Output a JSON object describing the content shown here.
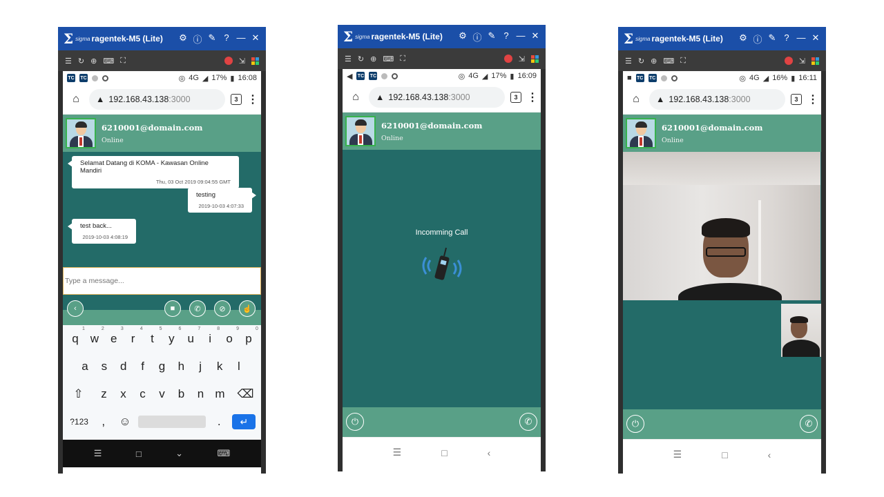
{
  "window": {
    "logo": "Σ",
    "logo_sub": "sigma",
    "title": "ragentek-M5 (Lite)",
    "title_icons": [
      "gear-icon",
      "info-icon",
      "pin-icon",
      "help-icon",
      "minimize-icon",
      "close-icon"
    ]
  },
  "browser": {
    "url_host": "192.168.43.138",
    "url_port": ":3000",
    "tab_count": "3"
  },
  "contact": {
    "name": "6210001@domain.com",
    "status": "Online"
  },
  "screens": {
    "chat": {
      "status": {
        "network": "4G",
        "battery": "17%",
        "time": "16:08"
      },
      "messages": [
        {
          "direction": "in",
          "text": "Selamat Datang di KOMA - Kawasan Online Mandiri",
          "time": "Thu, 03 Oct 2019 09:04:55 GMT"
        },
        {
          "direction": "out",
          "text": "testing",
          "time": "2019-10-03 4:07:33"
        },
        {
          "direction": "in",
          "text": "test back...",
          "time": "2019-10-03 4:08:19"
        }
      ],
      "input_placeholder": "Type a message...",
      "keyboard": {
        "row1": [
          [
            "q",
            "1"
          ],
          [
            "w",
            "2"
          ],
          [
            "e",
            "3"
          ],
          [
            "r",
            "4"
          ],
          [
            "t",
            "5"
          ],
          [
            "y",
            "6"
          ],
          [
            "u",
            "7"
          ],
          [
            "i",
            "8"
          ],
          [
            "o",
            "9"
          ],
          [
            "p",
            "0"
          ]
        ],
        "row2": [
          "a",
          "s",
          "d",
          "f",
          "g",
          "h",
          "j",
          "k",
          "l"
        ],
        "row3": [
          "z",
          "x",
          "c",
          "v",
          "b",
          "n",
          "m"
        ],
        "symbols_key": "?123",
        "comma_key": ",",
        "period_key": "."
      }
    },
    "incoming": {
      "status": {
        "network": "4G",
        "battery": "17%",
        "time": "16:09"
      },
      "label": "Incomming Call"
    },
    "video": {
      "status": {
        "network": "4G",
        "battery": "16%",
        "time": "16:11"
      }
    }
  },
  "colors": {
    "titlebar": "#1b4fa8",
    "header_green": "#59a087",
    "chat_bg": "#236b68",
    "enter_key": "#1a73e8"
  }
}
